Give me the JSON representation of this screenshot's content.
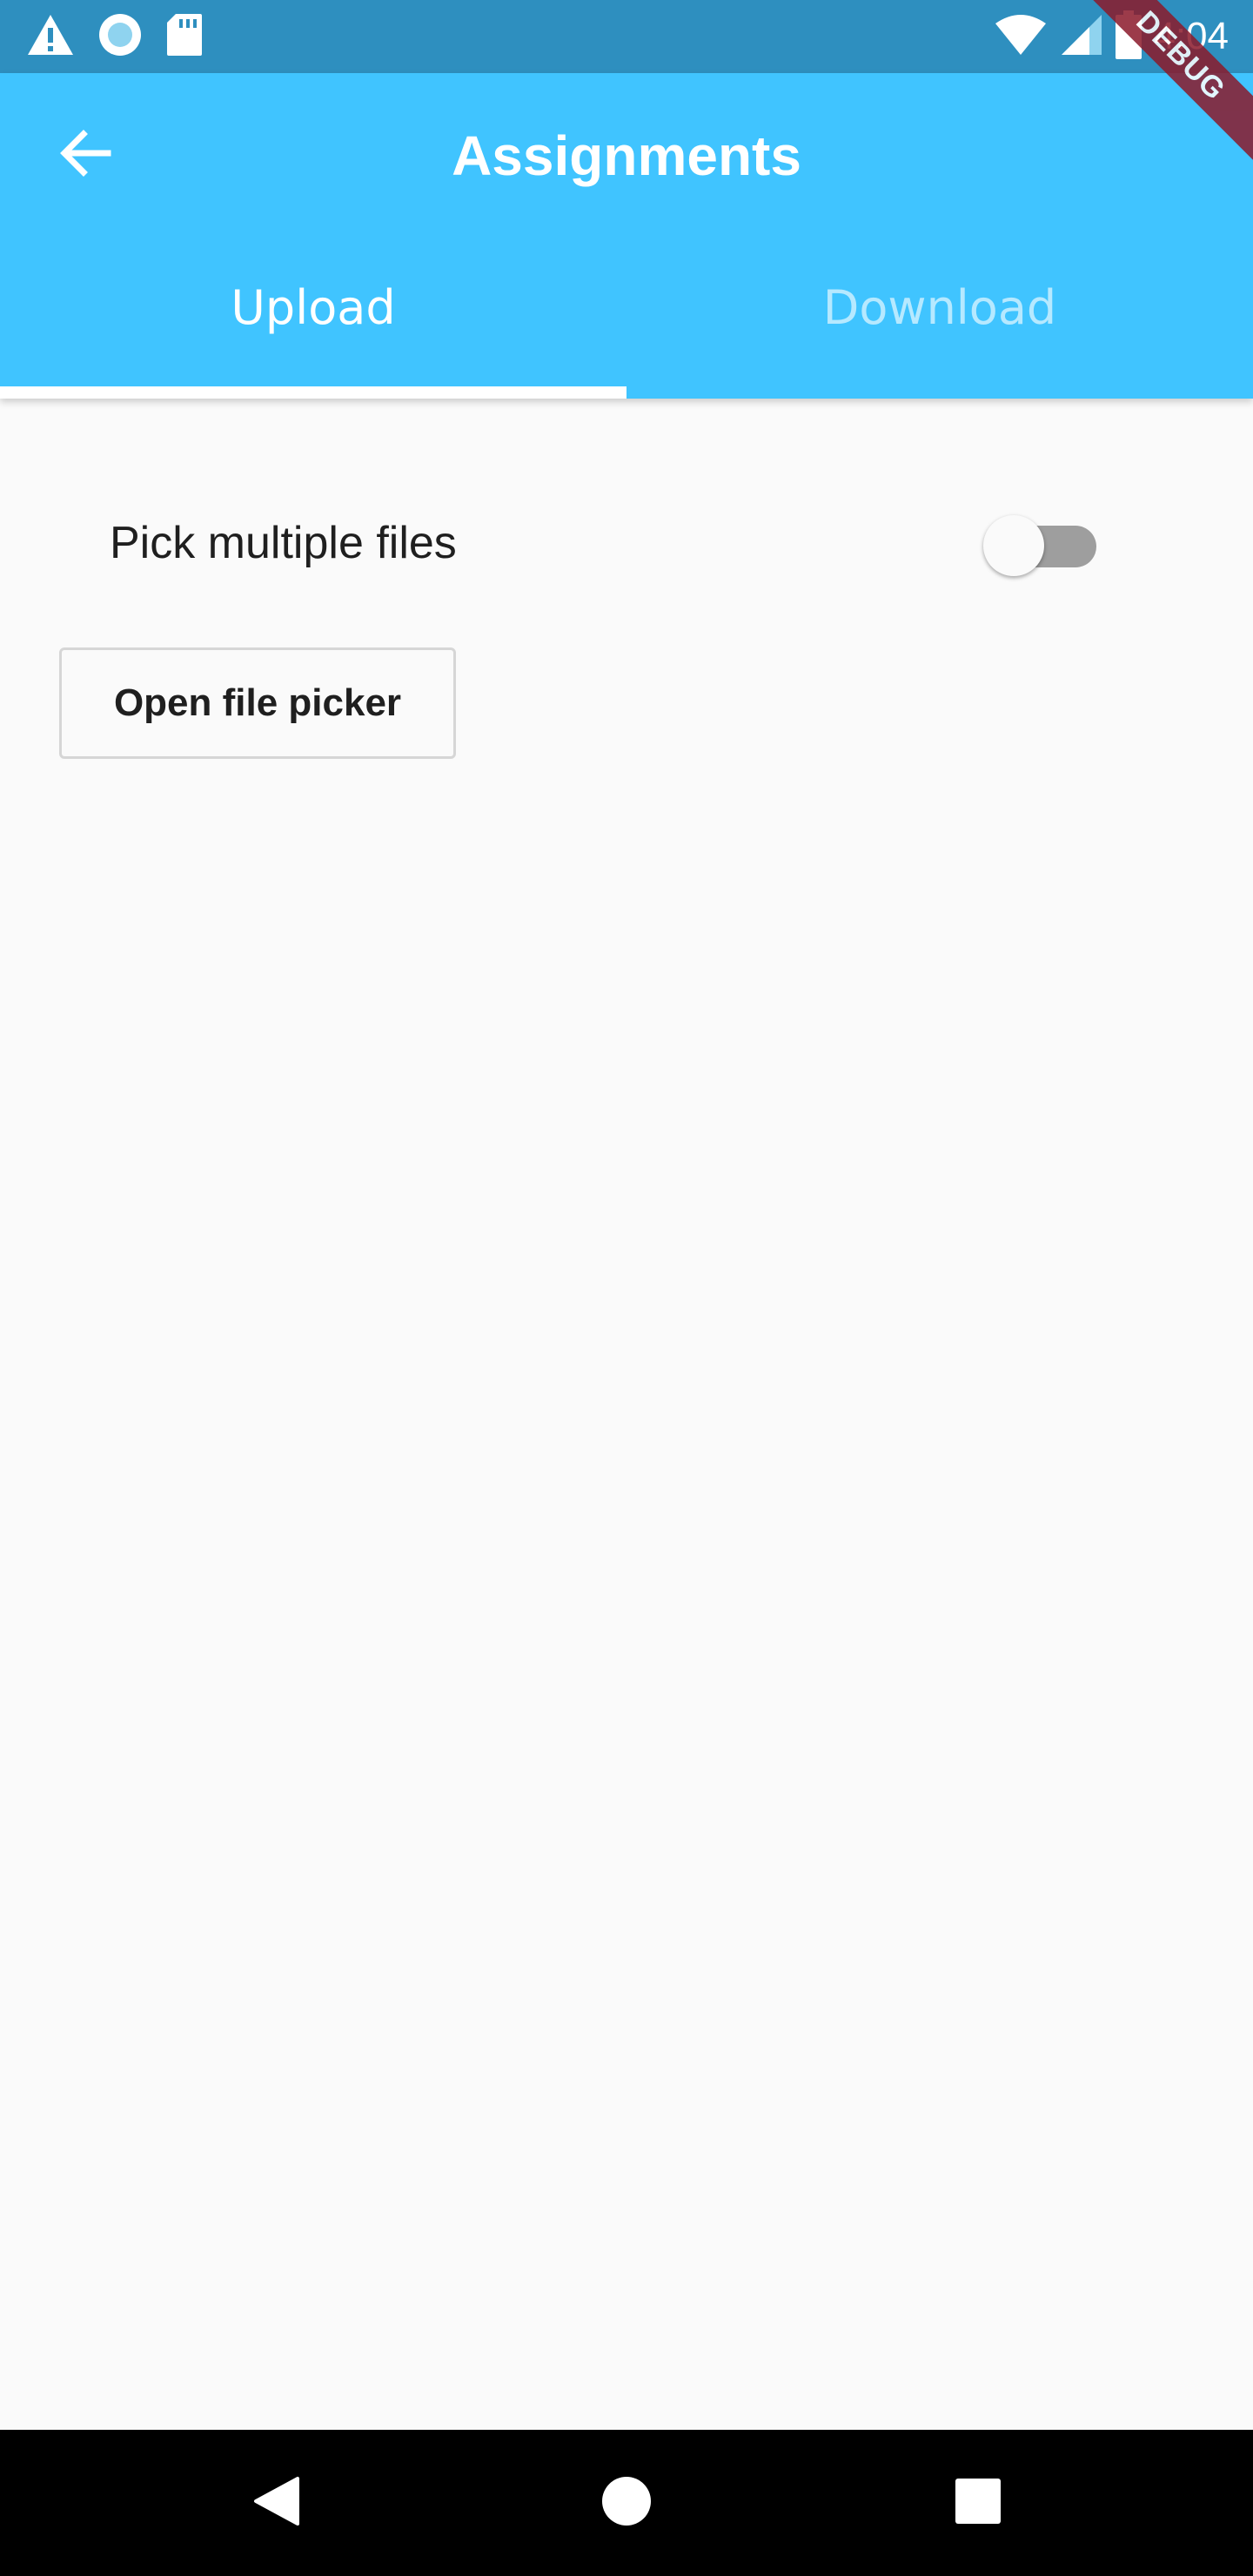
{
  "status_bar": {
    "time": "4:04",
    "icons_left": [
      "alert-icon",
      "sync-icon",
      "sd-card-icon"
    ],
    "icons_right": [
      "wifi-icon",
      "signal-icon",
      "battery-icon"
    ]
  },
  "app_bar": {
    "title": "Assignments",
    "back_icon": "arrow-back-icon",
    "color": "#40c4ff"
  },
  "tabs": [
    {
      "label": "Upload",
      "selected": true
    },
    {
      "label": "Download",
      "selected": false
    }
  ],
  "upload": {
    "multiple_label": "Pick multiple files",
    "multiple_enabled": false,
    "picker_button_label": "Open file picker"
  },
  "debug_banner": "DEBUG",
  "nav_bar": {
    "buttons": [
      "back-triangle-icon",
      "home-circle-icon",
      "recents-square-icon"
    ]
  }
}
